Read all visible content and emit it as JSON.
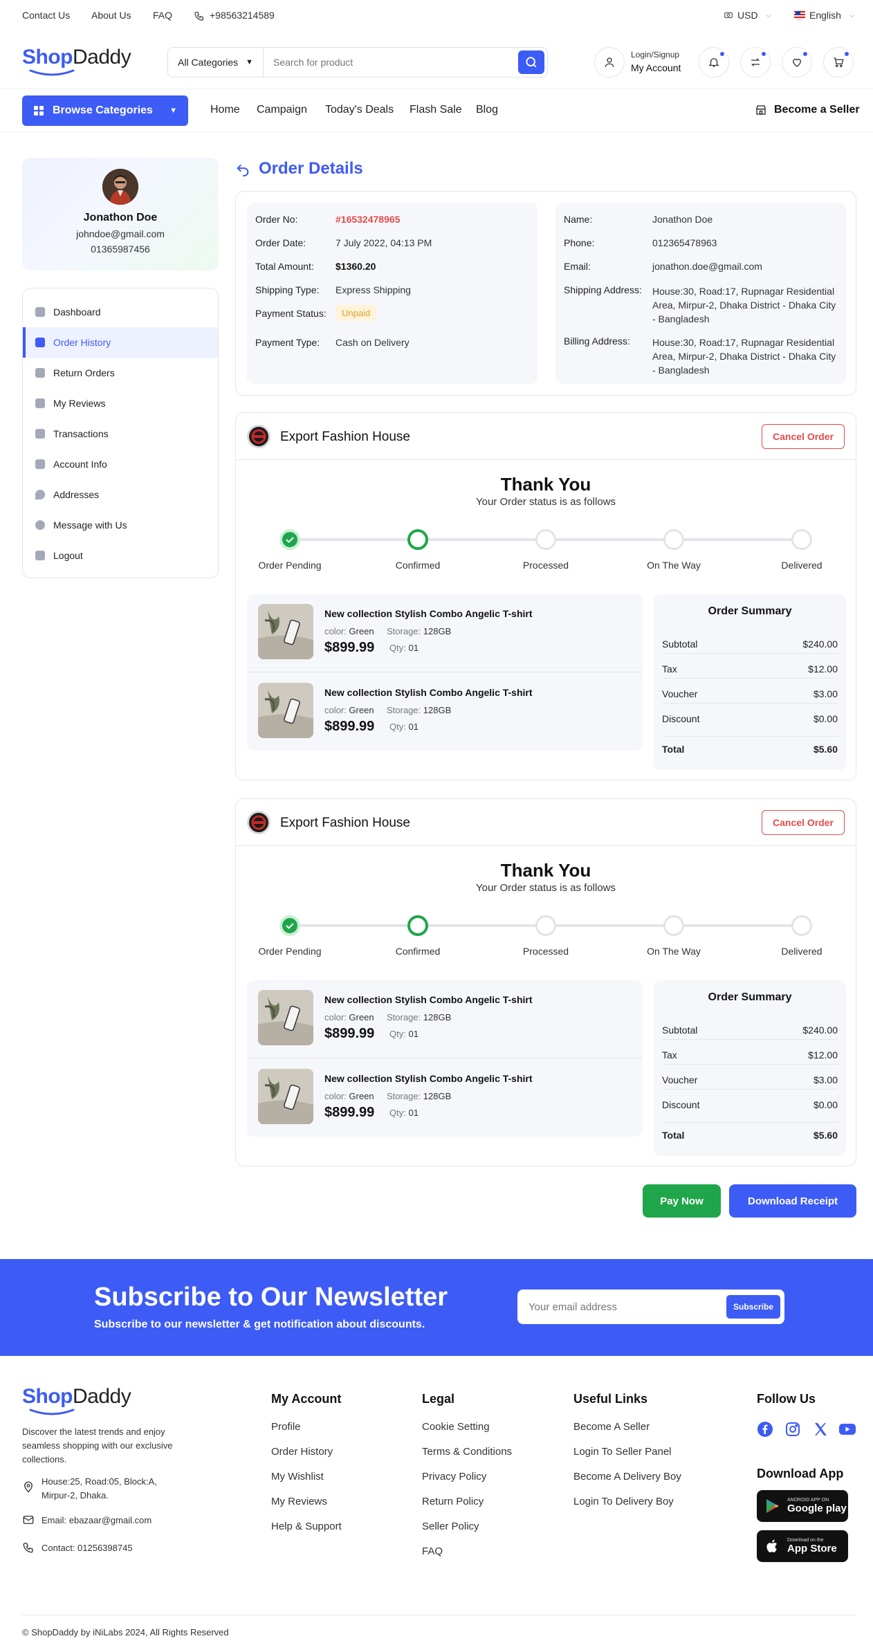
{
  "topbar": {
    "links": [
      "Contact Us",
      "About Us",
      "FAQ"
    ],
    "phone": "+98563214589",
    "currency": "USD",
    "language": "English"
  },
  "header": {
    "logo_part1": "Shop",
    "logo_part2": "Daddy",
    "category_select": "All Categories",
    "search_placeholder": "Search for product",
    "account_top": "Login/Signup",
    "account_bottom": "My Account"
  },
  "nav": {
    "browse": "Browse Categories",
    "links": [
      "Home",
      "Campaign",
      "Today's Deals",
      "Flash Sale",
      "Blog"
    ],
    "become_seller": "Become a Seller"
  },
  "profile": {
    "name": "Jonathon Doe",
    "email": "johndoe@gmail.com",
    "phone": "01365987456"
  },
  "sidebar": {
    "items": [
      {
        "label": "Dashboard",
        "icon": "dashboard-icon"
      },
      {
        "label": "Order History",
        "icon": "bag-icon"
      },
      {
        "label": "Return Orders",
        "icon": "return-icon"
      },
      {
        "label": "My Reviews",
        "icon": "review-icon"
      },
      {
        "label": "Transactions",
        "icon": "card-icon"
      },
      {
        "label": "Account Info",
        "icon": "id-icon"
      },
      {
        "label": "Addresses",
        "icon": "location-icon"
      },
      {
        "label": "Message with Us",
        "icon": "message-icon"
      },
      {
        "label": "Logout",
        "icon": "logout-icon"
      }
    ],
    "active_index": 1
  },
  "order": {
    "title": "Order Details",
    "left": [
      {
        "label": "Order No:",
        "value": "#16532478965"
      },
      {
        "label": "Order Date:",
        "value": "7 July 2022, 04:13 PM"
      },
      {
        "label": "Total Amount:",
        "value": "$1360.20"
      },
      {
        "label": "Shipping Type:",
        "value": "Express Shipping"
      },
      {
        "label": "Payment Status:",
        "value": "Unpaid"
      },
      {
        "label": "Payment Type:",
        "value": "Cash on Delivery"
      }
    ],
    "right": [
      {
        "label": "Name:",
        "value": "Jonathon Doe"
      },
      {
        "label": "Phone:",
        "value": "012365478963"
      },
      {
        "label": "Email:",
        "value": "jonathon.doe@gmail.com"
      },
      {
        "label": "Shipping Address:",
        "value": "House:30, Road:17, Rupnagar Residential Area, Mirpur-2, Dhaka District - Dhaka City - Bangladesh"
      },
      {
        "label": "Billing Address:",
        "value": "House:30, Road:17, Rupnagar Residential Area, Mirpur-2, Dhaka District - Dhaka City - Bangladesh"
      }
    ]
  },
  "shops": [
    {
      "name": "Export Fashion House",
      "cancel": "Cancel Order",
      "thank": "Thank You",
      "thank_sub": "Your Order status is as follows",
      "steps": [
        "Order Pending",
        "Confirmed",
        "Processed",
        "On The Way",
        "Delivered"
      ],
      "items": [
        {
          "name": "New collection Stylish Combo Angelic T-shirt",
          "color_label": "color:",
          "color": "Green",
          "storage_label": "Storage:",
          "storage": "128GB",
          "price": "$899.99",
          "qty_label": "Qty:",
          "qty": "01"
        },
        {
          "name": "New collection Stylish Combo Angelic T-shirt",
          "color_label": "color:",
          "color": "Green",
          "storage_label": "Storage:",
          "storage": "128GB",
          "price": "$899.99",
          "qty_label": "Qty:",
          "qty": "01"
        }
      ],
      "summary": {
        "title": "Order Summary",
        "rows": [
          {
            "label": "Subtotal",
            "value": "$240.00"
          },
          {
            "label": "Tax",
            "value": "$12.00"
          },
          {
            "label": "Voucher",
            "value": "$3.00"
          },
          {
            "label": "Discount",
            "value": "$0.00"
          }
        ],
        "total_label": "Total",
        "total_value": "$5.60"
      }
    },
    {
      "name": "Export Fashion House",
      "cancel": "Cancel Order",
      "thank": "Thank You",
      "thank_sub": "Your Order status is as follows",
      "steps": [
        "Order Pending",
        "Confirmed",
        "Processed",
        "On The Way",
        "Delivered"
      ],
      "items": [
        {
          "name": "New collection Stylish Combo Angelic T-shirt",
          "color_label": "color:",
          "color": "Green",
          "storage_label": "Storage:",
          "storage": "128GB",
          "price": "$899.99",
          "qty_label": "Qty:",
          "qty": "01"
        },
        {
          "name": "New collection Stylish Combo Angelic T-shirt",
          "color_label": "color:",
          "color": "Green",
          "storage_label": "Storage:",
          "storage": "128GB",
          "price": "$899.99",
          "qty_label": "Qty:",
          "qty": "01"
        }
      ],
      "summary": {
        "title": "Order Summary",
        "rows": [
          {
            "label": "Subtotal",
            "value": "$240.00"
          },
          {
            "label": "Tax",
            "value": "$12.00"
          },
          {
            "label": "Voucher",
            "value": "$3.00"
          },
          {
            "label": "Discount",
            "value": "$0.00"
          }
        ],
        "total_label": "Total",
        "total_value": "$5.60"
      }
    }
  ],
  "actions": {
    "pay": "Pay Now",
    "download": "Download Receipt"
  },
  "newsletter": {
    "title": "Subscribe to Our Newsletter",
    "subtitle": "Subscribe to our newsletter & get notification about discounts.",
    "placeholder": "Your email address",
    "button": "Subscribe"
  },
  "footer": {
    "desc": "Discover the latest trends and enjoy seamless shopping with our exclusive collections.",
    "address": "House:25, Road:05, Block:A, Mirpur-2, Dhaka.",
    "email": "Email: ebazaar@gmail.com",
    "contact": "Contact: 01256398745",
    "cols": [
      {
        "title": "My Account",
        "links": [
          "Profile",
          "Order History",
          "My Wishlist",
          "My Reviews",
          "Help & Support"
        ]
      },
      {
        "title": "Legal",
        "links": [
          "Cookie Setting",
          "Terms & Conditions",
          "Privacy Policy",
          "Return Policy",
          "Seller Policy",
          "FAQ"
        ]
      },
      {
        "title": "Useful Links",
        "links": [
          "Become A Seller",
          "Login To Seller Panel",
          "Become A Delivery Boy",
          "Login To Delivery Boy"
        ]
      }
    ],
    "follow_title": "Follow Us",
    "download_title": "Download App",
    "google_small": "ANDROID APP ON",
    "google_big": "Google play",
    "apple_small": "Download on the",
    "apple_big": "App Store",
    "copyright": "© ShopDaddy by iNiLabs 2024, All Rights Reserved"
  },
  "colors": {
    "primary": "#3d5bf5",
    "success": "#1fa64a",
    "danger": "#e24b4b",
    "order_no": "#e24b4b"
  }
}
